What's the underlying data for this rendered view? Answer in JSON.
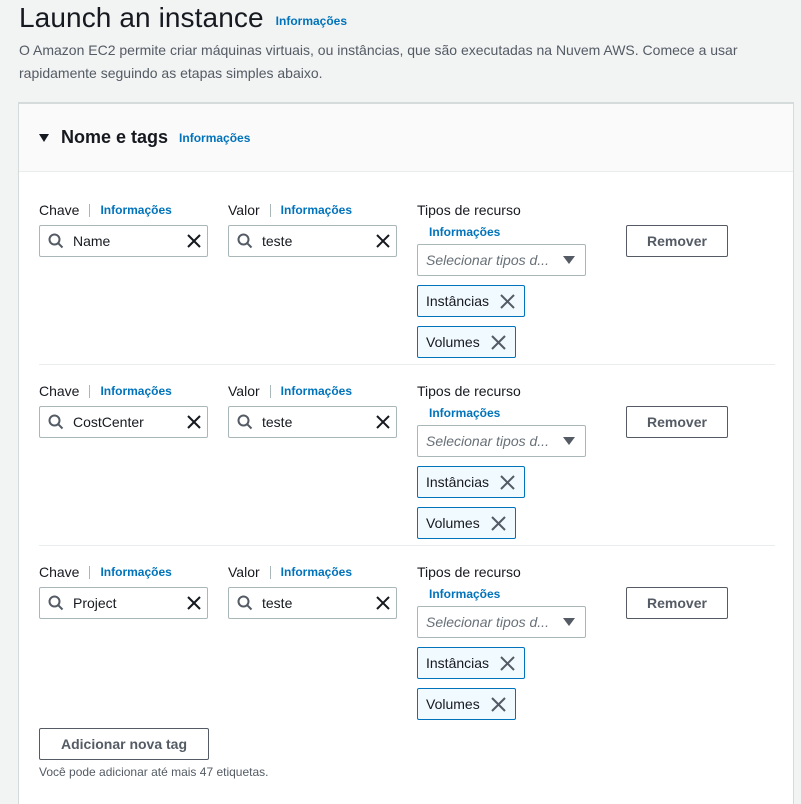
{
  "header": {
    "title": "Launch an instance",
    "info_link": "Informações",
    "description": "O Amazon EC2 permite criar máquinas virtuais, ou instâncias, que são executadas na Nuvem AWS. Comece a usar rapidamente seguindo as etapas simples abaixo."
  },
  "section": {
    "title": "Nome e tags",
    "info_link": "Informações"
  },
  "labels": {
    "key": "Chave",
    "value": "Valor",
    "resource_types": "Tipos de recurso",
    "info": "Informações"
  },
  "tags": [
    {
      "key": "Name",
      "value": "teste",
      "resource_placeholder": "Selecionar tipos d...",
      "tokens": [
        "Instâncias",
        "Volumes"
      ],
      "remove_label": "Remover"
    },
    {
      "key": "CostCenter",
      "value": "teste",
      "resource_placeholder": "Selecionar tipos d...",
      "tokens": [
        "Instâncias",
        "Volumes"
      ],
      "remove_label": "Remover"
    },
    {
      "key": "Project",
      "value": "teste",
      "resource_placeholder": "Selecionar tipos d...",
      "tokens": [
        "Instâncias",
        "Volumes"
      ],
      "remove_label": "Remover"
    }
  ],
  "add_tag_label": "Adicionar nova tag",
  "hint": "Você pode adicionar até mais 47 etiquetas.",
  "colors": {
    "link": "#0073bb",
    "token_border": "#0073bb",
    "token_bg": "#f1faff"
  }
}
